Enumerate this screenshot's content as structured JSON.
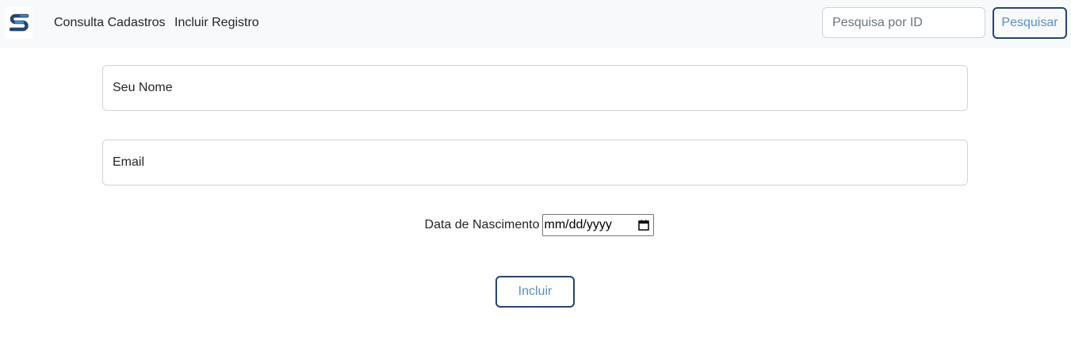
{
  "navbar": {
    "logo_icon": "s-logo-icon",
    "links": [
      {
        "label": "Consulta Cadastros"
      },
      {
        "label": "Incluir Registro"
      }
    ],
    "search": {
      "placeholder": "Pesquisa por ID",
      "value": "",
      "button_label": "Pesquisar"
    }
  },
  "form": {
    "name_placeholder": "Seu Nome",
    "email_placeholder": "Email",
    "date_label": "Data de Nascimento",
    "date_placeholder": "mm/dd/yyyy",
    "calendar_icon": "calendar-icon",
    "submit_label": "Incluir"
  },
  "colors": {
    "navbar_bg": "#f8f9fa",
    "button_border": "#27456e",
    "button_text": "#5a8fc0",
    "logo_dark": "#27456e",
    "logo_light": "#3d8fd0"
  }
}
